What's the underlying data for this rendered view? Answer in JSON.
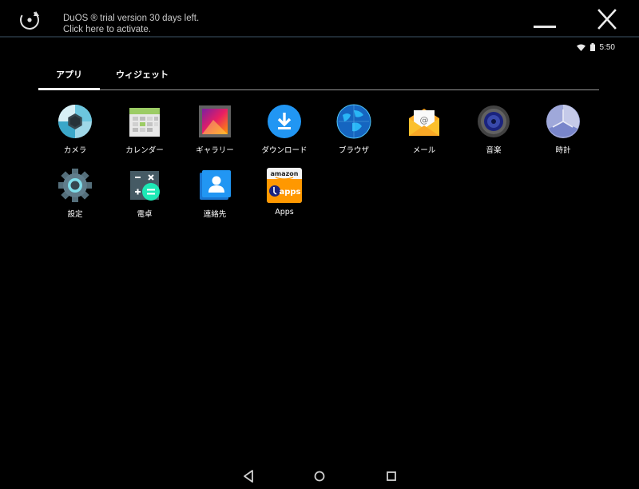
{
  "banner": {
    "line1": "DuOS ® trial version 30 days left.",
    "line2": "Click here to activate."
  },
  "status": {
    "time": "5:50"
  },
  "tabs": [
    {
      "label": "アプリ",
      "selected": true
    },
    {
      "label": "ウィジェット",
      "selected": false
    }
  ],
  "apps": [
    {
      "label": "カメラ",
      "icon": "camera-icon"
    },
    {
      "label": "カレンダー",
      "icon": "calendar-icon"
    },
    {
      "label": "ギャラリー",
      "icon": "gallery-icon"
    },
    {
      "label": "ダウンロード",
      "icon": "download-icon"
    },
    {
      "label": "ブラウザ",
      "icon": "browser-globe-icon"
    },
    {
      "label": "メール",
      "icon": "mail-icon"
    },
    {
      "label": "音楽",
      "icon": "music-speaker-icon"
    },
    {
      "label": "時計",
      "icon": "clock-icon"
    },
    {
      "label": "設定",
      "icon": "settings-gear-icon"
    },
    {
      "label": "電卓",
      "icon": "calculator-icon"
    },
    {
      "label": "連絡先",
      "icon": "contacts-icon"
    },
    {
      "label": "Apps",
      "icon": "amazon-appstore-icon",
      "icon_text_top": "amazon",
      "icon_text_bottom": "apps"
    }
  ],
  "colors": {
    "background": "#000000",
    "accent_blue": "#2196f3",
    "tab_indicator": "#ffffff"
  }
}
